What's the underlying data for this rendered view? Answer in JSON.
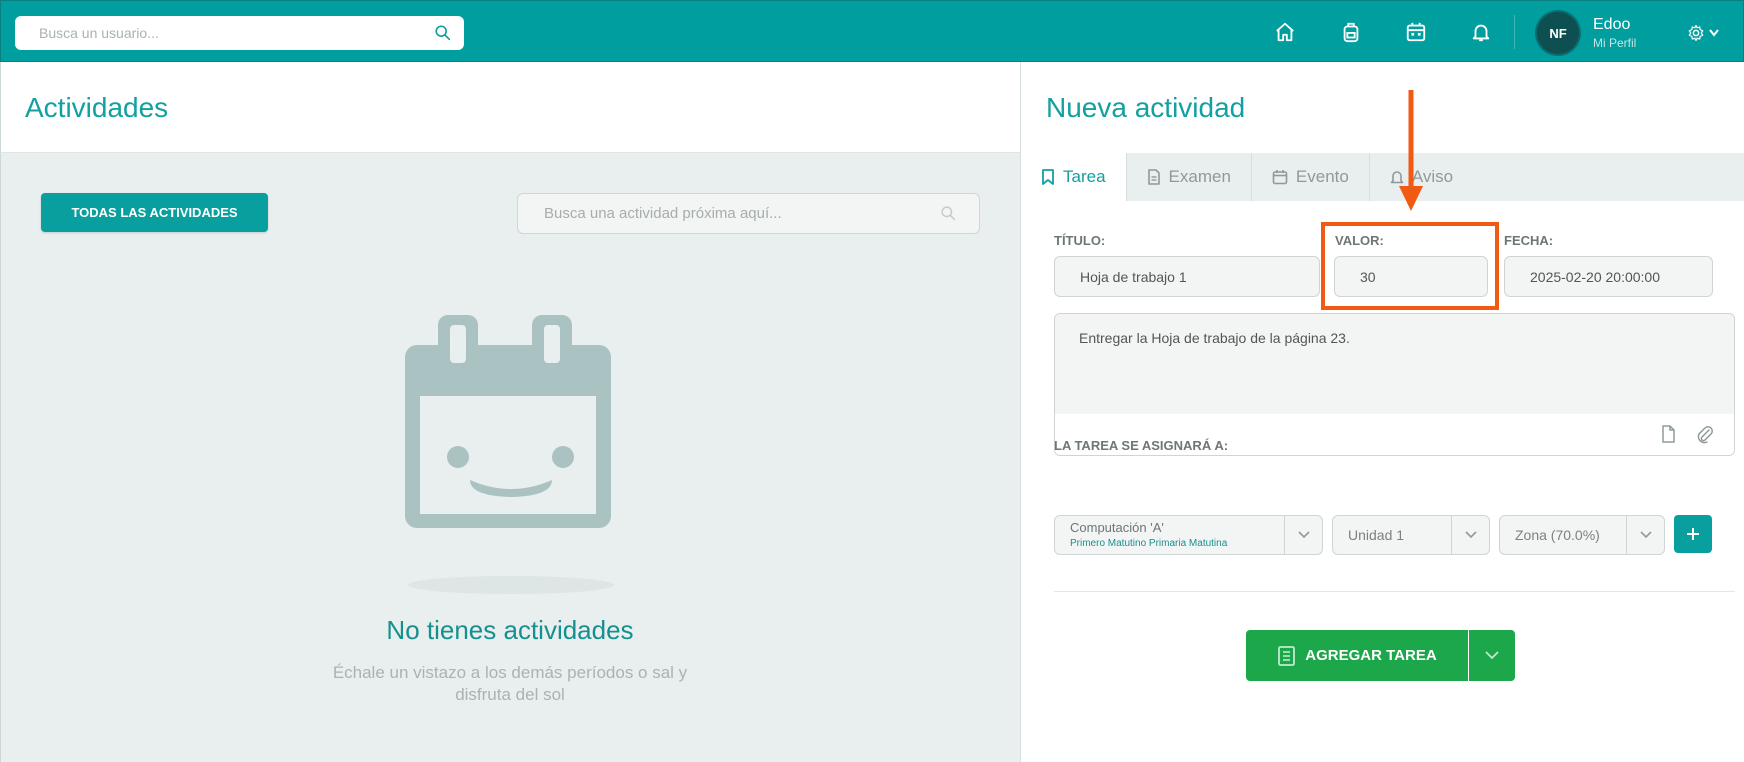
{
  "topbar": {
    "user_search_placeholder": "Busca un usuario...",
    "profile_initials": "NF",
    "profile_name": "Edoo",
    "profile_link": "Mi Perfil",
    "nav_icons": [
      "home-icon",
      "backpack-icon",
      "calendar-icon",
      "bell-icon"
    ]
  },
  "left": {
    "title": "Actividades",
    "all_button": "TODAS LAS ACTIVIDADES",
    "search_placeholder": "Busca una actividad próxima aquí...",
    "empty_title": "No tienes actividades",
    "empty_subtitle": "Échale un vistazo a los demás períodos o sal y disfruta del sol"
  },
  "right": {
    "title": "Nueva actividad",
    "tabs": [
      {
        "label": "Tarea",
        "icon": "bookmark-icon",
        "active": true
      },
      {
        "label": "Examen",
        "icon": "document-icon",
        "active": false
      },
      {
        "label": "Evento",
        "icon": "calendar-icon",
        "active": false
      },
      {
        "label": "Aviso",
        "icon": "bell-icon",
        "active": false
      }
    ],
    "labels": {
      "titulo": "TÍTULO:",
      "valor": "VALOR:",
      "fecha": "FECHA:",
      "assign": "LA TAREA SE ASIGNARÁ A:"
    },
    "fields": {
      "titulo": "Hoja de trabajo 1",
      "valor": "30",
      "fecha": "2025-02-20 20:00:00",
      "descripcion": "Entregar la Hoja de trabajo de la página 23."
    },
    "assign": {
      "course": "Computación 'A'",
      "course_sub": "Primero Matutino Primaria Matutina",
      "unit": "Unidad 1",
      "zone": "Zona (70.0%)"
    },
    "submit_label": "AGREGAR TAREA"
  },
  "colors": {
    "brand_teal": "#009e9e",
    "action_green": "#1ca84a",
    "annotation_orange": "#f15a13"
  }
}
